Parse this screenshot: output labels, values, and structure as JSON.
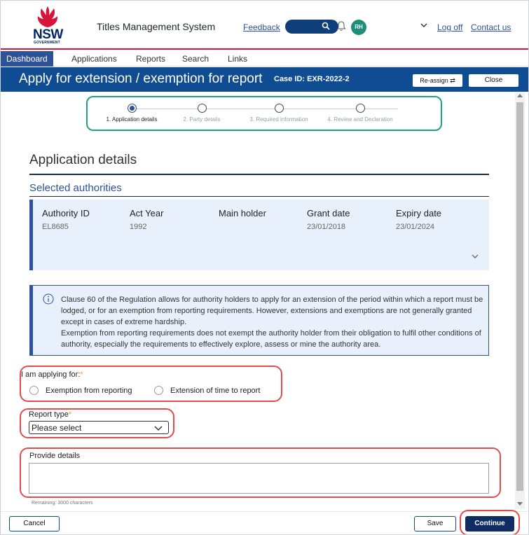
{
  "header": {
    "logo_text": "NSW",
    "logo_sub": "GOVERNMENT",
    "app_title": "Titles Management System",
    "feedback_link": "Feedback",
    "avatar_initials": "RH",
    "logoff_link": "Log off",
    "contact_link": "Contact us"
  },
  "nav": {
    "items": [
      "Dashboard",
      "Applications",
      "Reports",
      "Search",
      "Links"
    ],
    "active": "Dashboard"
  },
  "titlebar": {
    "title": "Apply for extension / exemption for report",
    "case_id": "Case ID: EXR-2022-2",
    "reassign_label": "Re-assign ⇄",
    "close_label": "Close"
  },
  "stepper": {
    "steps": [
      "1. Application details",
      "2. Party details",
      "3. Required information",
      "4. Review and Declaration"
    ],
    "active_index": 0
  },
  "main": {
    "section_title": "Application details",
    "subsection_title": "Selected authorities",
    "authority": {
      "headers": [
        "Authority ID",
        "Act Year",
        "Main holder",
        "Grant date",
        "Expiry date"
      ],
      "values": [
        "EL8685",
        "1992",
        "",
        "23/01/2018",
        "23/01/2024"
      ]
    },
    "info_text": "Clause 60 of the Regulation allows for authority holders to apply for an extension of the period within which a report must be lodged, or for an exemption from reporting requirements. However, extensions and exemptions are not generally granted except in cases of extreme hardship.",
    "info_text_2": "Exemption from reporting requirements does not exempt the authority holder from their obligation to fulfil other conditions of authority, especially the requirements to effectively explore, assess or mine the authority area."
  },
  "form": {
    "applying_label": "I am applying for:",
    "option_exemption": "Exemption from reporting",
    "option_extension": "Extension of time to report",
    "report_type_label": "Report type",
    "report_type_value": "Please select",
    "details_label": "Provide details",
    "remaining": "Remaining: 3000 characters",
    "required_marker": "*"
  },
  "footer": {
    "cancel_label": "Cancel",
    "save_label": "Save",
    "continue_label": "Continue"
  },
  "colors": {
    "brand_blue": "#0f4c91",
    "nav_active": "#2e5299",
    "nsw_red": "#d7153a",
    "highlight_red": "#e14d4d",
    "stepper_green": "#1fa37f",
    "continue_navy": "#0f2d63"
  }
}
